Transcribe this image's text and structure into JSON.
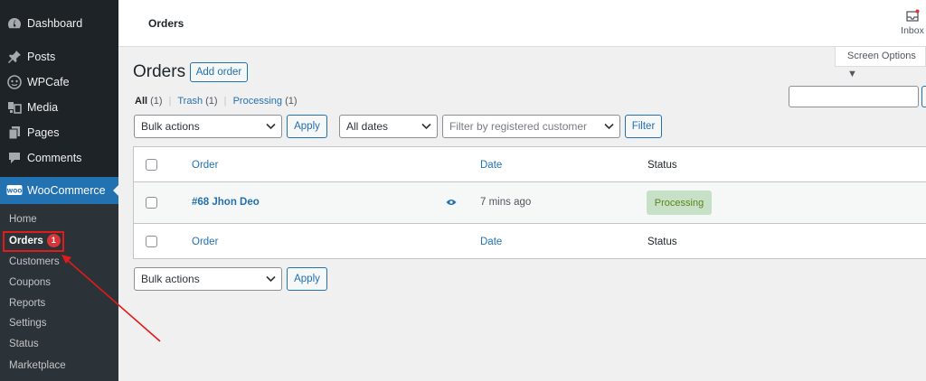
{
  "sidebar": {
    "items": [
      {
        "label": "Dashboard",
        "icon": "dashboard-icon"
      },
      {
        "label": "Posts",
        "icon": "pushpin-icon"
      },
      {
        "label": "WPCafe",
        "icon": "cafe-icon"
      },
      {
        "label": "Media",
        "icon": "media-icon"
      },
      {
        "label": "Pages",
        "icon": "pages-icon"
      },
      {
        "label": "Comments",
        "icon": "comment-icon"
      },
      {
        "label": "WooCommerce",
        "icon": "woocommerce-icon"
      }
    ],
    "woo_logo_text": "WOO",
    "submenu": [
      {
        "label": "Home"
      },
      {
        "label": "Orders",
        "badge": "1"
      },
      {
        "label": "Customers"
      },
      {
        "label": "Coupons"
      },
      {
        "label": "Reports"
      },
      {
        "label": "Settings"
      },
      {
        "label": "Status"
      },
      {
        "label": "Marketplace"
      }
    ]
  },
  "topbar": {
    "title": "Orders",
    "inbox_label": "Inbox"
  },
  "screen_options": "Screen Options ▼",
  "page": {
    "title": "Orders",
    "add_button": "Add order"
  },
  "filters": {
    "all_label": "All",
    "all_count": "(1)",
    "trash_label": "Trash",
    "trash_count": "(1)",
    "processing_label": "Processing",
    "processing_count": "(1)",
    "separator": "|"
  },
  "toolbar": {
    "bulk_actions": "Bulk actions",
    "apply": "Apply",
    "all_dates": "All dates",
    "customer_placeholder": "Filter by registered customer",
    "filter": "Filter"
  },
  "table": {
    "columns": [
      "Order",
      "Date",
      "Status"
    ],
    "rows": [
      {
        "order": "#68 Jhon Deo",
        "date": "7 mins ago",
        "status": "Processing"
      }
    ]
  },
  "colors": {
    "sidebar_bg": "#1d2327",
    "accent": "#2271b1",
    "status_processing_bg": "#c6e1c6",
    "status_processing_text": "#5b841b",
    "annotation": "#e11a1a"
  }
}
